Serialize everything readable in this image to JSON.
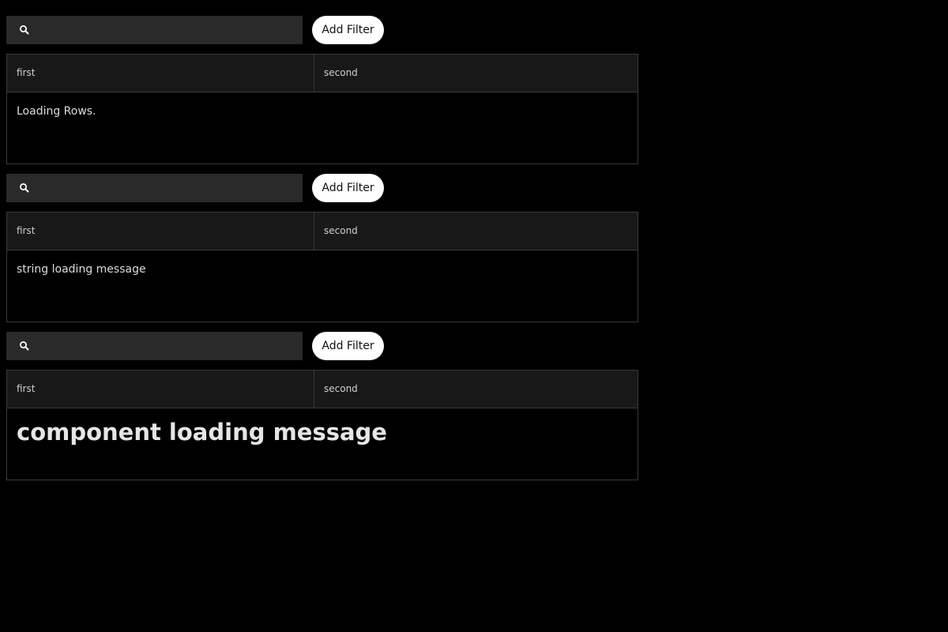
{
  "tables": [
    {
      "search": {
        "value": "",
        "placeholder": ""
      },
      "add_filter_label": "Add Filter",
      "columns": [
        "first",
        "second"
      ],
      "loading_message": "Loading Rows."
    },
    {
      "search": {
        "value": "",
        "placeholder": ""
      },
      "add_filter_label": "Add Filter",
      "columns": [
        "first",
        "second"
      ],
      "loading_message": "string loading message"
    },
    {
      "search": {
        "value": "",
        "placeholder": ""
      },
      "add_filter_label": "Add Filter",
      "columns": [
        "first",
        "second"
      ],
      "loading_message": "component loading message"
    }
  ],
  "icons": {
    "search": "search-icon"
  },
  "colors": {
    "background": "#000000",
    "search_bg": "#2a2a2a",
    "header_bg": "#181818",
    "border": "#3a3a3a",
    "button_bg": "#ffffff"
  }
}
